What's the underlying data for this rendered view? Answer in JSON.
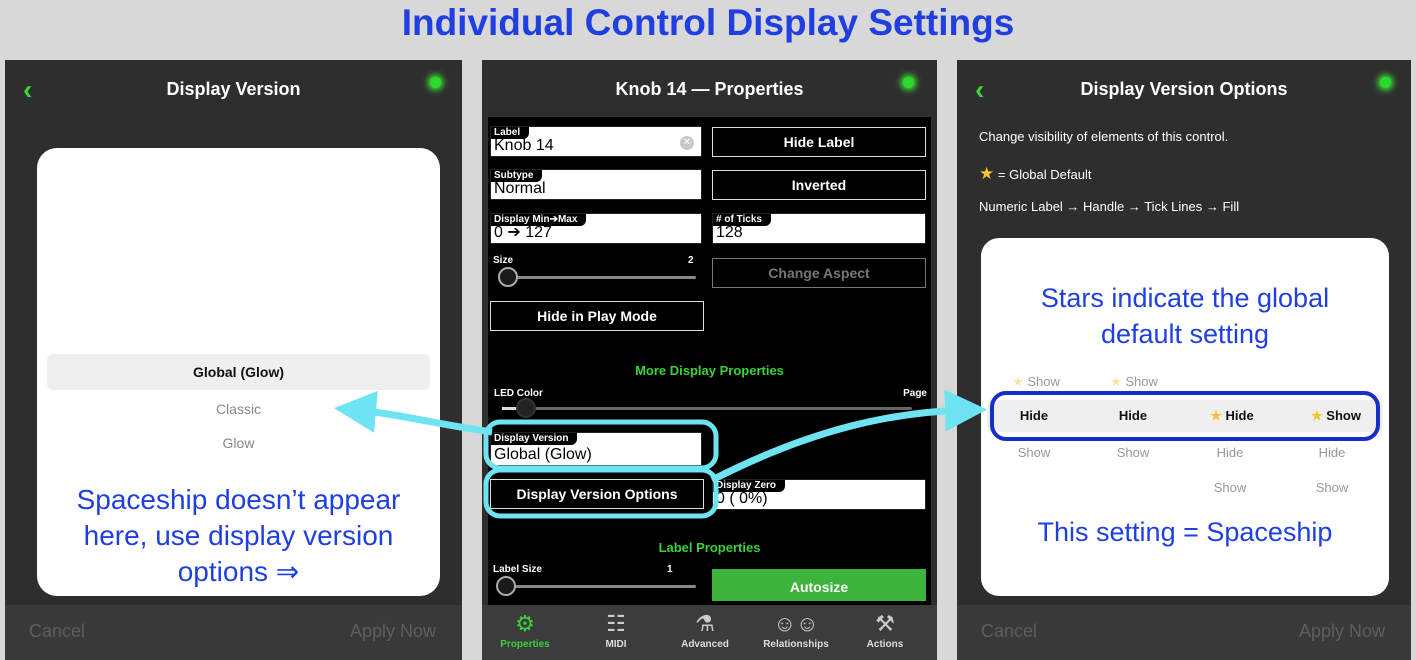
{
  "title": "Individual Control Display Settings",
  "left": {
    "title": "Display Version",
    "back_icon": "chevron-left-icon",
    "options": [
      "Global (Glow)",
      "Classic",
      "Glow"
    ],
    "note": "Spaceship doesn’t appear here, use display version options ⇒",
    "note_lines": [
      "Spaceship doesn’t appear",
      "here, use display version",
      "options ⇒"
    ],
    "cancel": "Cancel",
    "apply": "Apply Now"
  },
  "middle": {
    "title": "Knob 14 — Properties",
    "label_tag": "Label",
    "label_value": "Knob 14",
    "hide_label": "Hide Label",
    "subtype_tag": "Subtype",
    "subtype_value": "Normal",
    "inverted": "Inverted",
    "minmax_tag": "Display Min➔Max",
    "minmax_value": "0 ➔ 127",
    "ticks_tag": "# of Ticks",
    "ticks_value": "128",
    "size_label": "Size",
    "size_value": "2",
    "change_aspect": "Change Aspect",
    "hide_play": "Hide in Play Mode",
    "more_display": "More Display Properties",
    "led_color": "LED Color",
    "page": "Page",
    "display_version_tag": "Display Version",
    "display_version_value": "Global (Glow)",
    "display_zero_tag": "Display Zero",
    "display_zero_value": "0 (  0%)",
    "display_version_options": "Display Version Options",
    "label_properties": "Label Properties",
    "label_size": "Label Size",
    "label_size_value": "1",
    "autosize": "Autosize",
    "tabs": [
      {
        "label": "Properties",
        "icon": "gear-icon",
        "active": true
      },
      {
        "label": "MIDI",
        "icon": "sliders-icon",
        "active": false
      },
      {
        "label": "Advanced",
        "icon": "flask-icon",
        "active": false
      },
      {
        "label": "Relationships",
        "icon": "people-icon",
        "active": false
      },
      {
        "label": "Actions",
        "icon": "wrench-icon",
        "active": false
      }
    ]
  },
  "right": {
    "title": "Display Version Options",
    "back_icon": "chevron-left-icon",
    "info1": "Change visibility of elements of this control.",
    "info2": "= Global Default",
    "info3": "Numeric Label → Handle → Tick Lines → Fill",
    "stars_note_lines": [
      "Stars indicate the global",
      "default setting"
    ],
    "columns": [
      {
        "above": "Show",
        "above_star": true,
        "selected": "Hide",
        "selected_star": false,
        "below": [
          "Show"
        ]
      },
      {
        "above": "Show",
        "above_star": true,
        "selected": "Hide",
        "selected_star": false,
        "below": [
          "Show"
        ]
      },
      {
        "above": "",
        "above_star": false,
        "selected": "Hide",
        "selected_star": true,
        "below": [
          "Hide",
          "Show"
        ]
      },
      {
        "above": "",
        "above_star": false,
        "selected": "Show",
        "selected_star": true,
        "below": [
          "Hide",
          "Show"
        ]
      }
    ],
    "setting_note": "This setting = Spaceship",
    "cancel": "Cancel",
    "apply": "Apply Now"
  },
  "colors": {
    "title_blue": "#1f3fe0",
    "accent_green": "#3cd03c",
    "highlight_cyan": "#6ee3f2",
    "highlight_navy": "#1430c8"
  }
}
